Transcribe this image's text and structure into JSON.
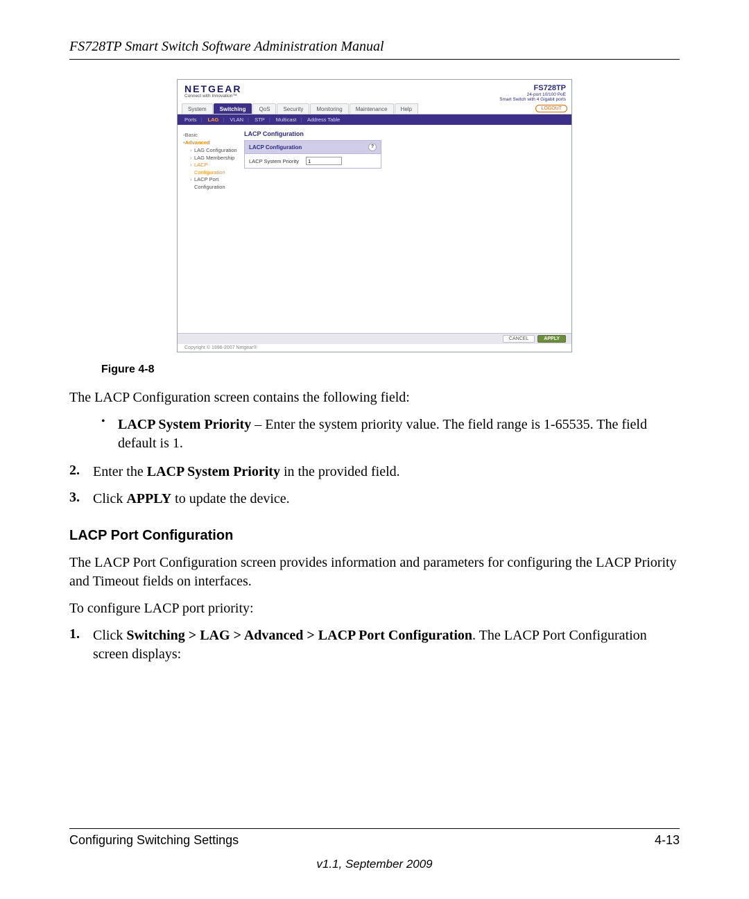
{
  "doc": {
    "header_title": "FS728TP Smart Switch Software Administration Manual",
    "figure_label": "Figure 4-8",
    "intro": "The LACP Configuration screen contains the following field:",
    "bullet_lead": "LACP System Priority",
    "bullet_rest": " – Enter the system priority value. The field range is 1-65535. The field default is 1.",
    "step2_num": "2.",
    "step2_pre": "Enter the ",
    "step2_bold": "LACP System Priority",
    "step2_post": " in the provided field.",
    "step3_num": "3.",
    "step3_pre": "Click ",
    "step3_bold": "APPLY",
    "step3_post": " to update the device.",
    "section_heading": "LACP Port Configuration",
    "para1": "The LACP Port Configuration screen provides information and parameters for configuring the LACP Priority and Timeout fields on interfaces.",
    "para2": "To configure LACP port priority:",
    "step1_num": "1.",
    "step1_pre": "Click ",
    "step1_bold": "Switching > LAG > Advanced > LACP Port Configuration",
    "step1_post": ". The LACP Port Configuration screen displays:",
    "footer_left": "Configuring Switching Settings",
    "footer_right": "4-13",
    "footer_version": "v1.1, September 2009"
  },
  "shot": {
    "brand": "NETGEAR",
    "brand_tag": "Connect with Innovation™",
    "product_model": "FS728TP",
    "product_sub1": "24-port 10/100 PoE",
    "product_sub2": "Smart Switch with 4 Gigabit ports",
    "tabs": [
      "System",
      "Switching",
      "QoS",
      "Security",
      "Monitoring",
      "Maintenance",
      "Help"
    ],
    "active_tab": "Switching",
    "logout": "LOGOUT",
    "subtabs": [
      "Ports",
      "LAG",
      "VLAN",
      "STP",
      "Multicast",
      "Address Table"
    ],
    "active_subtab": "LAG",
    "side_basic": "Basic",
    "side_advanced": "Advanced",
    "side_items": [
      "LAG Configuration",
      "LAG Membership",
      "LACP Configuration",
      "LACP Port Configuration"
    ],
    "side_selected": "LACP Configuration",
    "panel_title": "LACP Configuration",
    "panel_box_head": "LACP Configuration",
    "field_label": "LACP System Priority",
    "field_value": "1",
    "cancel": "CANCEL",
    "apply": "APPLY",
    "copyright": "Copyright © 1996-2007 Netgear®"
  }
}
